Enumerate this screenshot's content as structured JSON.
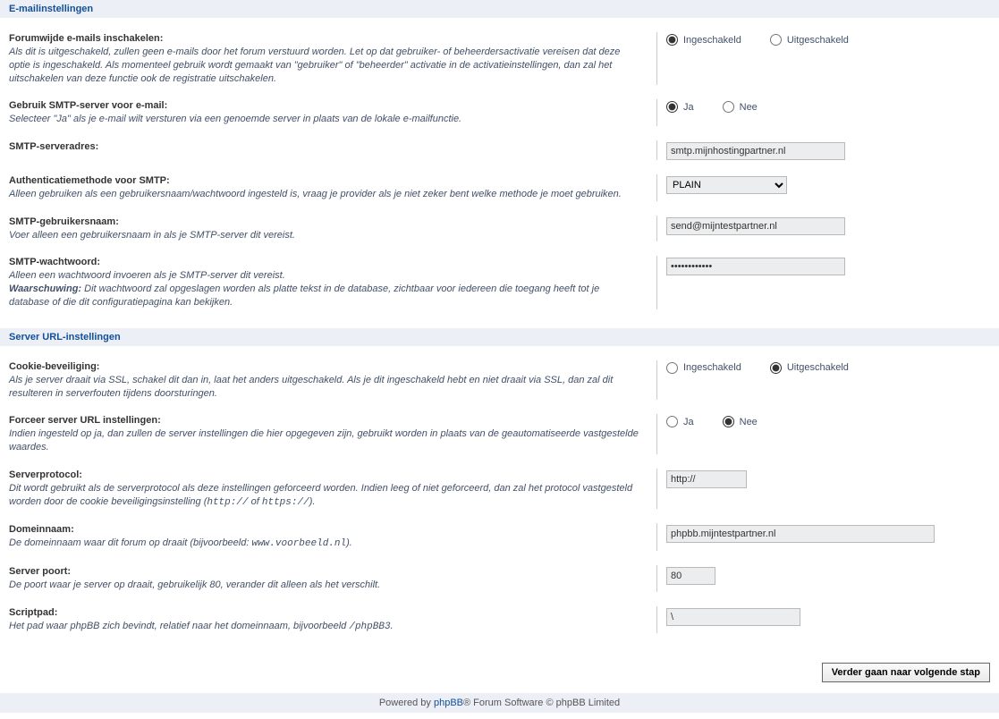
{
  "email": {
    "heading": "E-mailinstellingen",
    "rows": {
      "enable": {
        "label": "Forumwijde e-mails inschakelen:",
        "desc": "Als dit is uitgeschakeld, zullen geen e-mails door het forum verstuurd worden. Let op dat gebruiker- of beheerdersactivatie vereisen dat deze optie is ingeschakeld. Als momenteel gebruik wordt gemaakt van \"gebruiker\" of \"beheerder\" activatie in de activatieinstellingen, dan zal het uitschakelen van deze functie ook de registratie uitschakelen.",
        "opt1": "Ingeschakeld",
        "opt2": "Uitgeschakeld"
      },
      "smtp": {
        "label": "Gebruik SMTP-server voor e-mail:",
        "desc": "Selecteer \"Ja\" als je e-mail wilt versturen via een genoemde server in plaats van de lokale e-mailfunctie.",
        "opt1": "Ja",
        "opt2": "Nee"
      },
      "addr": {
        "label": "SMTP-serveradres:",
        "value": "smtp.mijnhostingpartner.nl"
      },
      "auth": {
        "label": "Authenticatiemethode voor SMTP:",
        "desc": "Alleen gebruiken als een gebruikersnaam/wachtwoord ingesteld is, vraag je provider als je niet zeker bent welke methode je moet gebruiken.",
        "value": "PLAIN"
      },
      "user": {
        "label": "SMTP-gebruikersnaam:",
        "desc": "Voer alleen een gebruikersnaam in als je SMTP-server dit vereist.",
        "value": "send@mijntestpartner.nl"
      },
      "pass": {
        "label": "SMTP-wachtwoord:",
        "desc_pre": "Alleen een wachtwoord invoeren als je SMTP-server dit vereist.",
        "warn": "Waarschuwing:",
        "desc_post": " Dit wachtwoord zal opgeslagen worden als platte tekst in de database, zichtbaar voor iedereen die toegang heeft tot je database of die dit configuratiepagina kan bekijken.",
        "value": "●●●●●●●●●●●●"
      }
    }
  },
  "server": {
    "heading": "Server URL-instellingen",
    "rows": {
      "cookie": {
        "label": "Cookie-beveiliging:",
        "desc": "Als je server draait via SSL, schakel dit dan in, laat het anders uitgeschakeld. Als je dit ingeschakeld hebt en niet draait via SSL, dan zal dit resulteren in serverfouten tijdens doorsturingen.",
        "opt1": "Ingeschakeld",
        "opt2": "Uitgeschakeld"
      },
      "force": {
        "label": "Forceer server URL instellingen:",
        "desc": "Indien ingesteld op ja, dan zullen de server instellingen die hier opgegeven zijn, gebruikt worden in plaats van de geautomatiseerde vastgestelde waardes.",
        "opt1": "Ja",
        "opt2": "Nee"
      },
      "protocol": {
        "label": "Serverprotocol:",
        "desc_a": "Dit wordt gebruikt als de serverprotocol als deze instellingen geforceerd worden. Indien leeg of niet geforceerd, dan zal het protocol vastgesteld worden door de cookie beveiligingsinstelling (",
        "mono1": "http://",
        "of": " of ",
        "mono2": "https://",
        "close": ").",
        "value": "http://"
      },
      "domain": {
        "label": "Domeinnaam:",
        "desc_a": "De domeinnaam waar dit forum op draait (bijvoorbeeld: ",
        "mono": "www.voorbeeld.nl",
        "close": ").",
        "value": "phpbb.mijntestpartner.nl"
      },
      "port": {
        "label": "Server poort:",
        "desc": "De poort waar je server op draait, gebruikelijk 80, verander dit alleen als het verschilt.",
        "value": "80"
      },
      "script": {
        "label": "Scriptpad:",
        "desc_a": "Het pad waar phpBB zich bevindt, relatief naar het domeinnaam, bijvoorbeeld ",
        "mono": "/phpBB3",
        "close": ".",
        "value": "\\"
      }
    }
  },
  "submit": "Verder gaan naar volgende stap",
  "footer": {
    "pre": "Powered by ",
    "link": "phpBB",
    "post": "® Forum Software © phpBB Limited"
  }
}
